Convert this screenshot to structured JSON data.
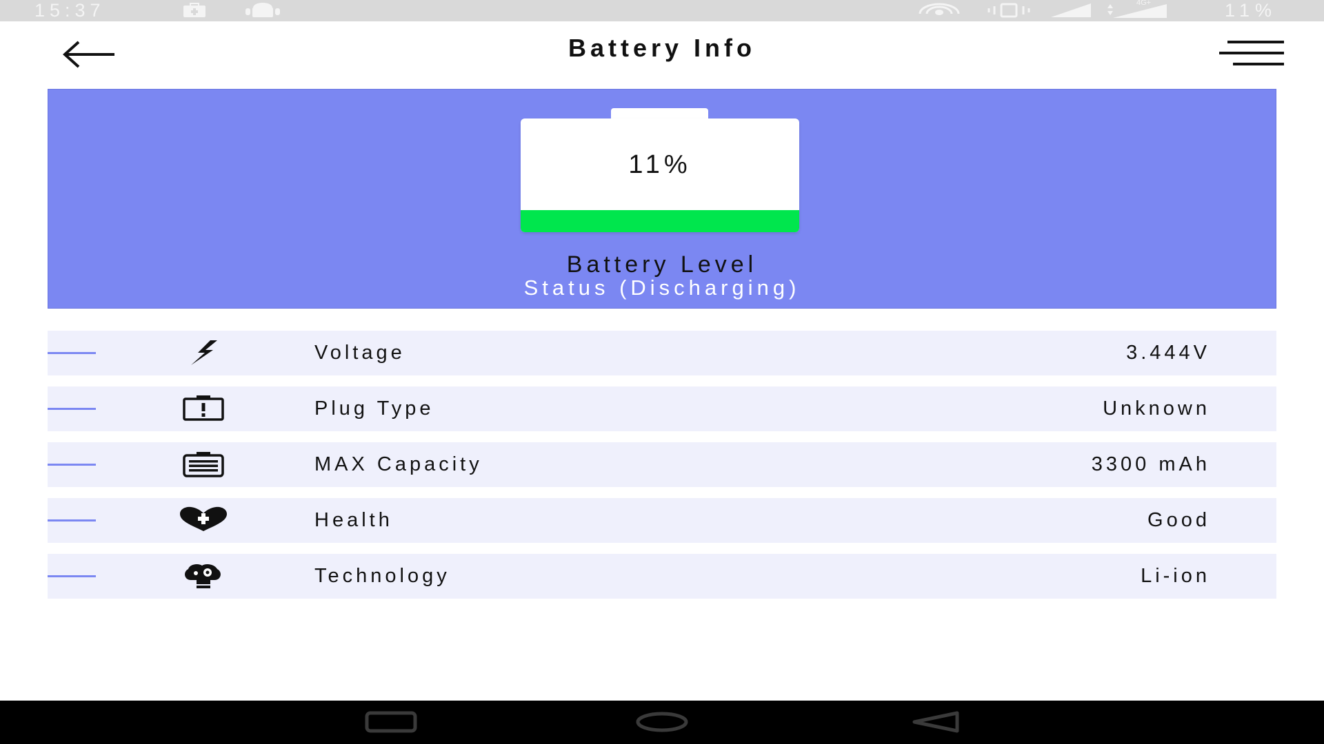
{
  "status_bar": {
    "time": "15:37",
    "battery_percent": "11%",
    "icons": [
      "medical-kit-icon",
      "android-icon",
      "hotspot-icon",
      "vibrate-icon",
      "signal-icon",
      "data-4g-signal-icon"
    ],
    "network_label": "4G+"
  },
  "app_bar": {
    "title": "Battery Info",
    "icons": [
      "back-arrow-icon",
      "menu-icon"
    ]
  },
  "battery_card": {
    "percent_text": "11%",
    "level_fraction": 0.11,
    "level_label": "Battery Level",
    "status_label": "Status (Discharging)",
    "background_color": "#7b87f2",
    "fill_color": "#00e64d"
  },
  "info": [
    {
      "icon": "lightning-icon",
      "label": "Voltage",
      "value": "3.444V"
    },
    {
      "icon": "plug-alert-icon",
      "label": "Plug Type",
      "value": "Unknown"
    },
    {
      "icon": "battery-capacity-icon",
      "label": "MAX Capacity",
      "value": "3300 mAh"
    },
    {
      "icon": "health-heart-icon",
      "label": "Health",
      "value": "Good"
    },
    {
      "icon": "technology-brain-icon",
      "label": "Technology",
      "value": "Li-ion"
    }
  ],
  "nav_bar": {
    "icons": [
      "recents-icon",
      "home-icon",
      "back-triangle-icon"
    ]
  }
}
